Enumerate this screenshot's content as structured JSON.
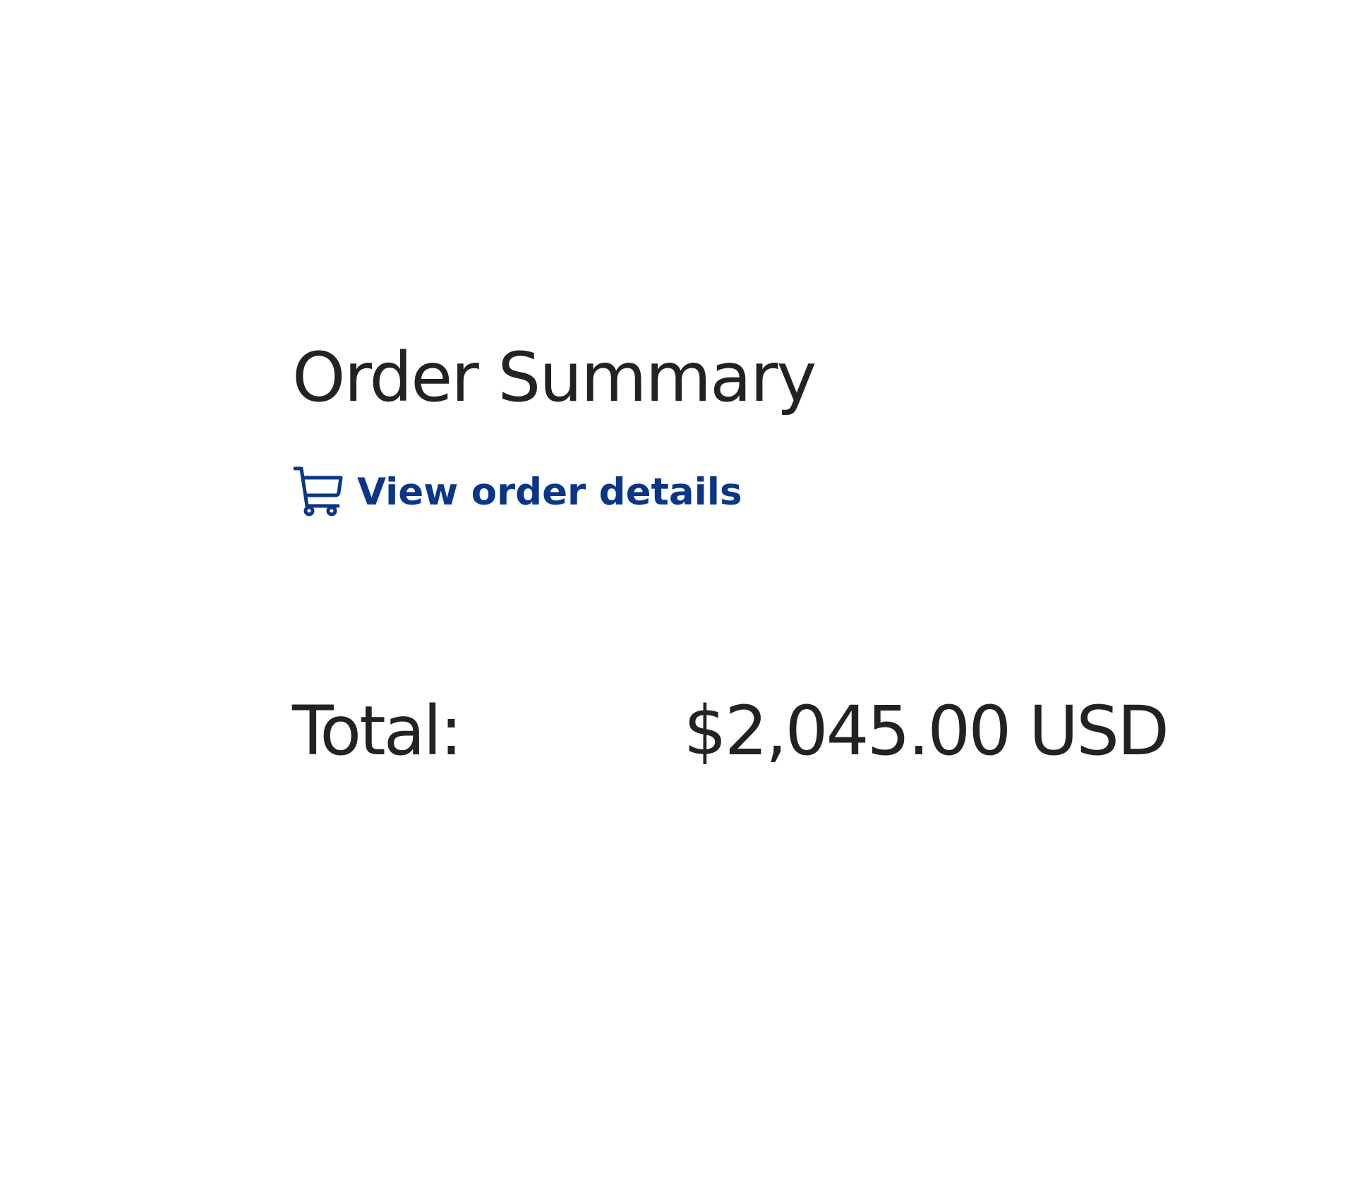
{
  "order_summary": {
    "title": "Order Summary",
    "details_link": {
      "label": "View order details",
      "icon": "cart-icon"
    },
    "total": {
      "label": "Total:",
      "value": "$2,045.00 USD"
    }
  },
  "colors": {
    "text": "#222222",
    "link": "#0b3688",
    "background": "#ffffff"
  }
}
